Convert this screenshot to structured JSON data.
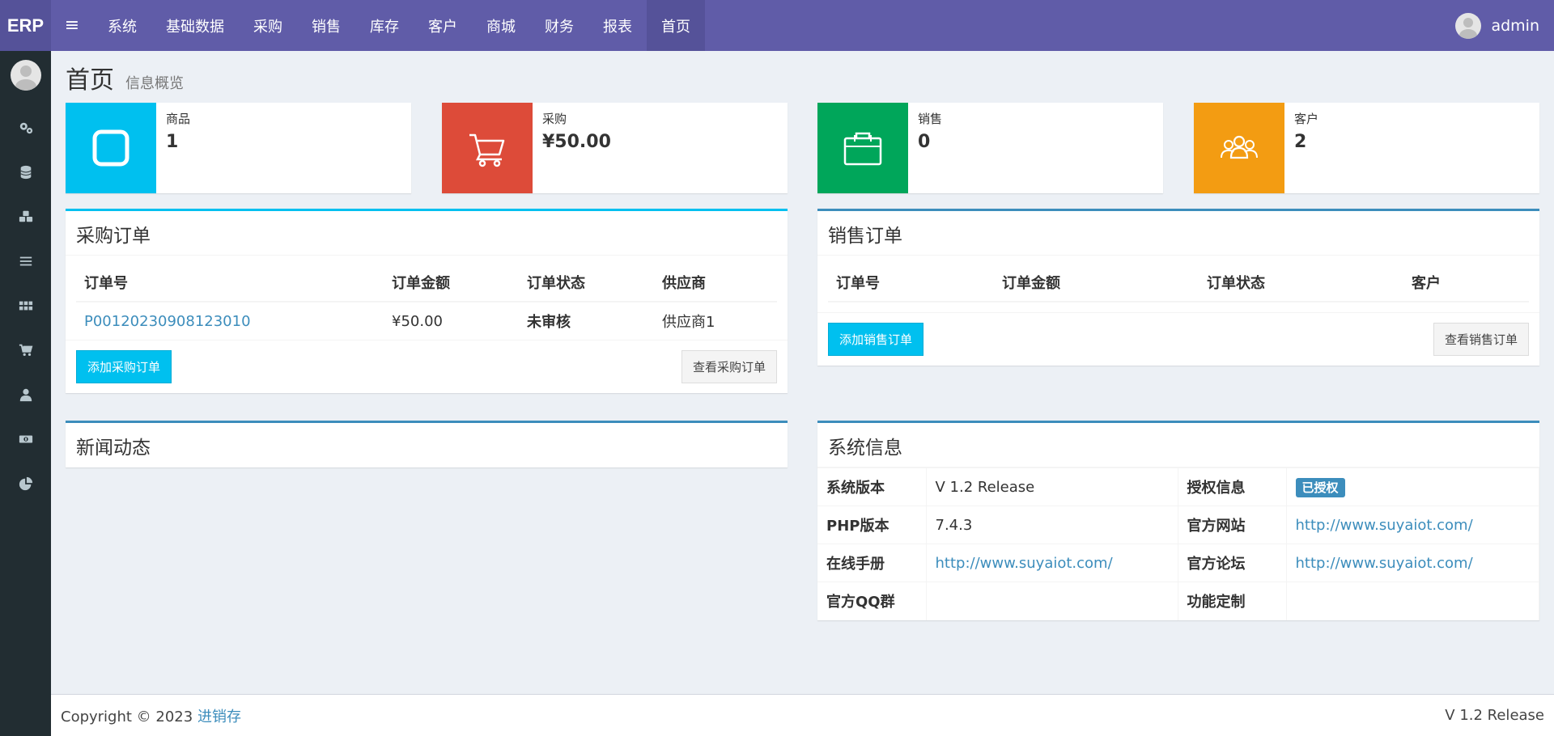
{
  "app": {
    "logo": "ERP",
    "menu_toggle": "≡",
    "nav": [
      "系统",
      "基础数据",
      "采购",
      "销售",
      "库存",
      "客户",
      "商城",
      "财务",
      "报表",
      "首页"
    ],
    "active_nav": "首页",
    "user": "admin",
    "colors": {
      "navbar": "#605ca8",
      "sidebar": "#222d32",
      "aqua": "#00c0ef",
      "red": "#dd4b39",
      "green": "#00a65a",
      "yellow": "#f39c12",
      "blue": "#3c8dbc"
    }
  },
  "sidebar": {
    "icons": [
      "gears-icon",
      "database-icon",
      "cubes-icon",
      "list-icon",
      "grid-icon",
      "cart-icon",
      "user-icon",
      "money-icon",
      "pie-chart-icon"
    ]
  },
  "header": {
    "title": "首页",
    "subtitle": "信息概览"
  },
  "stats": {
    "goods": {
      "label": "商品",
      "value": "1",
      "icon": "square-icon"
    },
    "purchase": {
      "label": "采购",
      "value": "¥50.00",
      "icon": "cart-icon"
    },
    "sales": {
      "label": "销售",
      "value": "0",
      "icon": "briefcase-icon"
    },
    "customers": {
      "label": "客户",
      "value": "2",
      "icon": "users-icon"
    }
  },
  "purchase_orders": {
    "title": "采购订单",
    "columns": [
      "订单号",
      "订单金额",
      "订单状态",
      "供应商"
    ],
    "rows": [
      {
        "order_no": "P00120230908123010",
        "amount": "¥50.00",
        "status": "未审核",
        "supplier": "供应商1"
      }
    ],
    "add_button": "添加采购订单",
    "view_button": "查看采购订单"
  },
  "sales_orders": {
    "title": "销售订单",
    "columns": [
      "订单号",
      "订单金额",
      "订单状态",
      "客户"
    ],
    "add_button": "添加销售订单",
    "view_button": "查看销售订单"
  },
  "news": {
    "title": "新闻动态"
  },
  "system_info": {
    "title": "系统信息",
    "version_label": "系统版本",
    "version": "V 1.2 Release",
    "license_label": "授权信息",
    "license": "已授权",
    "php_label": "PHP版本",
    "php": "7.4.3",
    "site_label": "官方网站",
    "site": "http://www.suyaiot.com/",
    "manual_label": "在线手册",
    "manual": "http://www.suyaiot.com/",
    "forum_label": "官方论坛",
    "forum": "http://www.suyaiot.com/",
    "qq_label": "官方QQ群",
    "qq": "",
    "custom_label": "功能定制",
    "custom": ""
  },
  "footer": {
    "copyright": "Copyright © 2023",
    "brand": "进销存",
    "version": "V 1.2 Release"
  }
}
